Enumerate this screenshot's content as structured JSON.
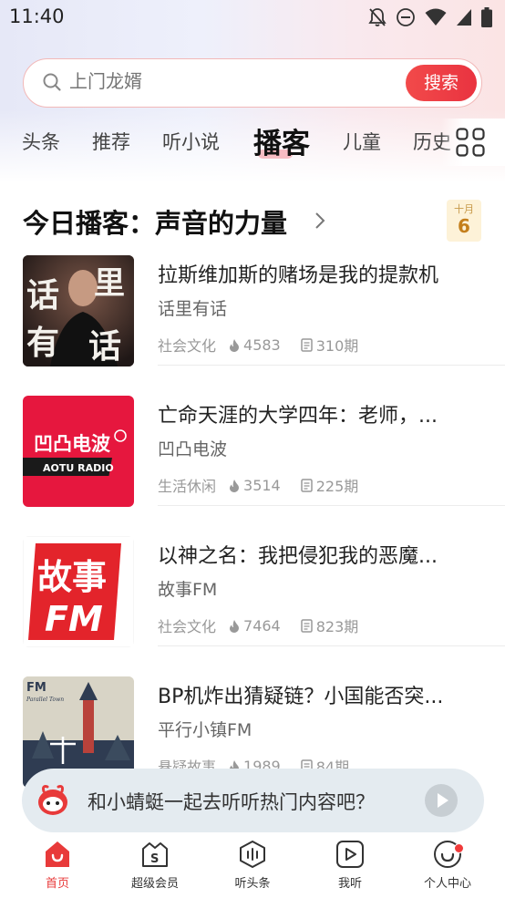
{
  "status_bar": {
    "time": "11:40"
  },
  "search": {
    "placeholder": "上门龙婿",
    "button_label": "搜索"
  },
  "tabs": [
    {
      "label": "头条"
    },
    {
      "label": "推荐"
    },
    {
      "label": "听小说"
    },
    {
      "label": "播客",
      "active": true
    },
    {
      "label": "儿童"
    },
    {
      "label": "历史"
    }
  ],
  "section": {
    "title": "今日播客：声音的力量",
    "calendar": {
      "month": "十月",
      "day": "6"
    }
  },
  "items": [
    {
      "title": "拉斯维加斯的赌场是我的提款机",
      "author": "话里有话",
      "category": "社会文化",
      "plays": "4583",
      "episodes": "310期",
      "cover_text": "话里有话"
    },
    {
      "title": "亡命天涯的大学四年：老师，...",
      "author": "凹凸电波",
      "category": "生活休闲",
      "plays": "3514",
      "episodes": "225期",
      "cover_text": "凹凸电波",
      "cover_subtext": "AOTU RADIO"
    },
    {
      "title": "以神之名：我把侵犯我的恶魔...",
      "author": "故事FM",
      "category": "社会文化",
      "plays": "7464",
      "episodes": "823期",
      "cover_text": "故事",
      "cover_subtext": "FM"
    },
    {
      "title": "BP机炸出猜疑链？小国能否突...",
      "author": "平行小镇FM",
      "category": "悬疑故事",
      "plays": "1989",
      "episodes": "84期",
      "cover_text": "FM",
      "cover_subtext": "Parallel Town"
    }
  ],
  "mini_player": {
    "text": "和小蜻蜓一起去听听热门内容吧？"
  },
  "bottom_nav": [
    {
      "label": "首页",
      "icon": "home-icon",
      "active": true
    },
    {
      "label": "超级会员",
      "icon": "vip-icon"
    },
    {
      "label": "听头条",
      "icon": "headline-icon"
    },
    {
      "label": "我听",
      "icon": "my-listen-icon"
    },
    {
      "label": "个人中心",
      "icon": "profile-icon"
    }
  ],
  "colors": {
    "accent": "#e93340",
    "calendar_day": "#c47f1c"
  }
}
